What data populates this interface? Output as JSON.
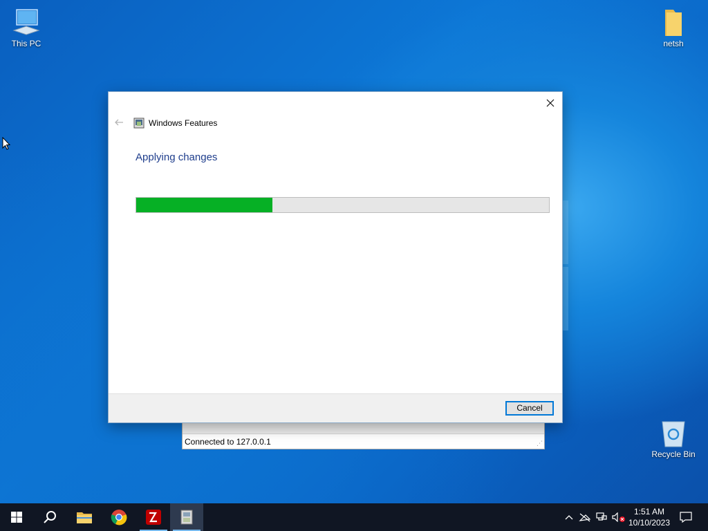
{
  "desktop": {
    "icons": [
      {
        "label": "This PC",
        "icon": "computer-icon"
      },
      {
        "label": "netsh",
        "icon": "folder-icon"
      },
      {
        "label": "Recycle Bin",
        "icon": "recycle-bin-icon"
      }
    ]
  },
  "background_window": {
    "status_text": "Connected to 127.0.0.1"
  },
  "dialog": {
    "title": "Windows Features",
    "heading": "Applying changes",
    "progress_fraction": 0.33,
    "progress_color": "#06b025",
    "cancel_label": "Cancel",
    "close_icon": "close-icon",
    "back_icon": "back-arrow-icon"
  },
  "taskbar": {
    "items": [
      {
        "name": "start",
        "icon": "windows-logo-icon"
      },
      {
        "name": "search",
        "icon": "search-icon"
      },
      {
        "name": "file-explorer",
        "icon": "folder-icon"
      },
      {
        "name": "chrome",
        "icon": "chrome-icon"
      },
      {
        "name": "filezilla",
        "icon": "filezilla-icon"
      },
      {
        "name": "windows-features",
        "icon": "windows-features-icon",
        "active": true
      }
    ],
    "tray": {
      "icons": [
        "chevron-up-icon",
        "network-disconnected-icon",
        "network-icon",
        "volume-muted-icon"
      ],
      "time": "1:51 AM",
      "date": "10/10/2023",
      "notification_icon": "notification-icon"
    }
  }
}
